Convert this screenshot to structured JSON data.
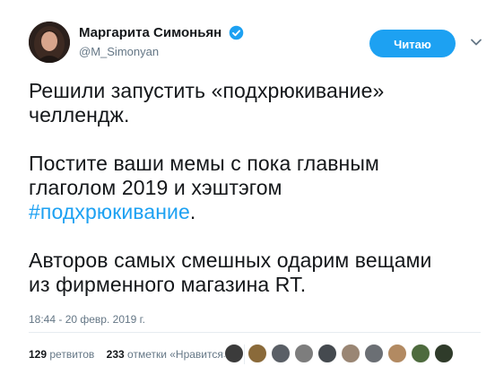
{
  "author": {
    "display_name": "Маргарита Симоньян",
    "handle": "@M_Simonyan",
    "verified": true,
    "avatar_icon": "profile-photo-avatar"
  },
  "follow_button": {
    "label": "Читаю"
  },
  "tweet": {
    "line1": "Решили запустить «подхрюкивание»",
    "line2": "челлендж.",
    "line3": "Постите ваши мемы с пока главным",
    "line4_pre": "глаголом 2019 и хэштэгом",
    "hashtag": "#подхрюкивание",
    "line5_post": ".",
    "line6": "Авторов самых смешных одарим вещами",
    "line7": "из фирменного магазина RT."
  },
  "timestamp": "18:44 - 20 февр. 2019 г.",
  "stats": {
    "retweets_count": "129",
    "retweets_label": "ретвитов",
    "likes_count": "233",
    "likes_label": "отметки «Нравится»"
  },
  "liker_avatars": [
    {
      "color": "#3b3b3b"
    },
    {
      "color": "#8a6a3a"
    },
    {
      "color": "#5a5f66"
    },
    {
      "color": "#7d7d7d"
    },
    {
      "color": "#454a4f"
    },
    {
      "color": "#9a8674"
    },
    {
      "color": "#6b6f74"
    },
    {
      "color": "#b28a62"
    },
    {
      "color": "#4e6b3e"
    },
    {
      "color": "#2f3b2a"
    }
  ],
  "colors": {
    "accent": "#1da1f2",
    "text": "#14171a",
    "muted": "#657786"
  }
}
